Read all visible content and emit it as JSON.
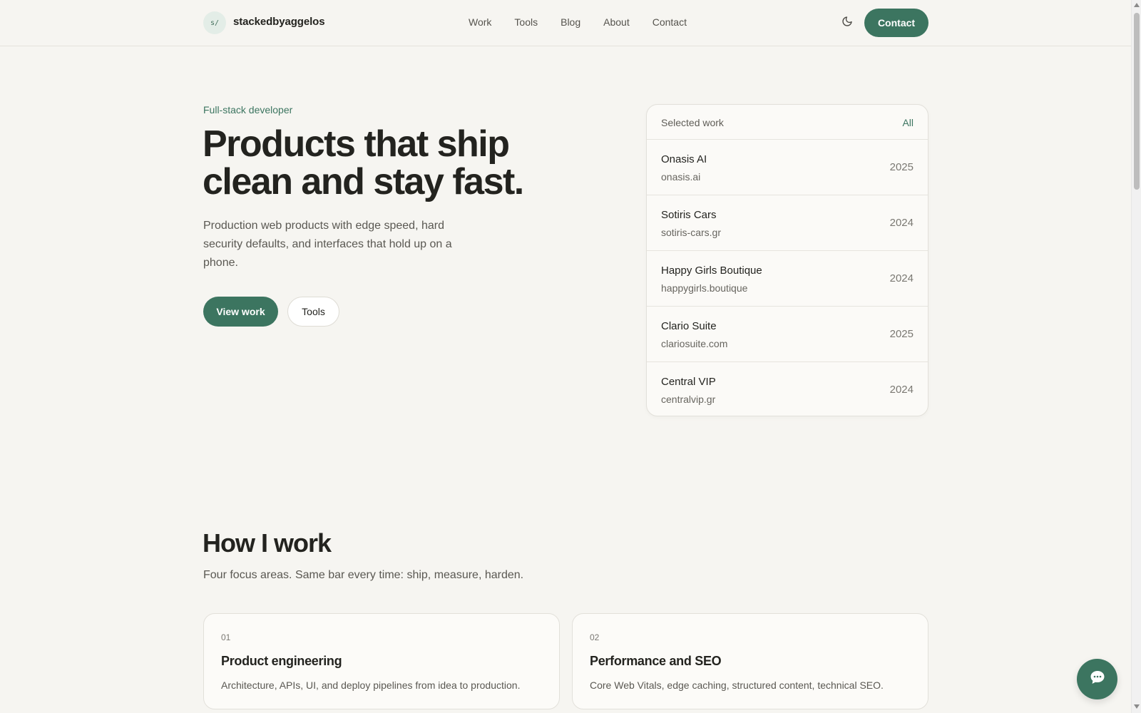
{
  "header": {
    "logo_badge": "s/",
    "brand": "stackedbyaggelos",
    "nav": [
      "Work",
      "Tools",
      "Blog",
      "About",
      "Contact"
    ],
    "theme_toggle_icon": "moon-icon",
    "contact_label": "Contact"
  },
  "hero": {
    "eyebrow": "Full-stack developer",
    "title": "Products that ship clean and stay fast.",
    "subtitle": "Production web products with edge speed, hard security defaults, and interfaces that hold up on a phone.",
    "primary_cta": "View work",
    "secondary_cta": "Tools"
  },
  "work": {
    "title": "Selected work",
    "all_label": "All",
    "items": [
      {
        "name": "Onasis AI",
        "domain": "onasis.ai",
        "year": "2025"
      },
      {
        "name": "Sotiris Cars",
        "domain": "sotiris-cars.gr",
        "year": "2024"
      },
      {
        "name": "Happy Girls Boutique",
        "domain": "happygirls.boutique",
        "year": "2024"
      },
      {
        "name": "Clario Suite",
        "domain": "clariosuite.com",
        "year": "2025"
      },
      {
        "name": "Central VIP",
        "domain": "centralvip.gr",
        "year": "2024"
      }
    ]
  },
  "how": {
    "title": "How I work",
    "subtitle": "Four focus areas. Same bar every time: ship, measure, harden.",
    "cards": [
      {
        "num": "01",
        "title": "Product engineering",
        "desc": "Architecture, APIs, UI, and deploy pipelines from idea to production."
      },
      {
        "num": "02",
        "title": "Performance and SEO",
        "desc": "Core Web Vitals, edge caching, structured content, technical SEO."
      }
    ]
  },
  "chat": {
    "icon": "chat-bubble-icon"
  },
  "colors": {
    "accent": "#3c7560",
    "background": "#f6f5f1",
    "text": "#23231f"
  }
}
